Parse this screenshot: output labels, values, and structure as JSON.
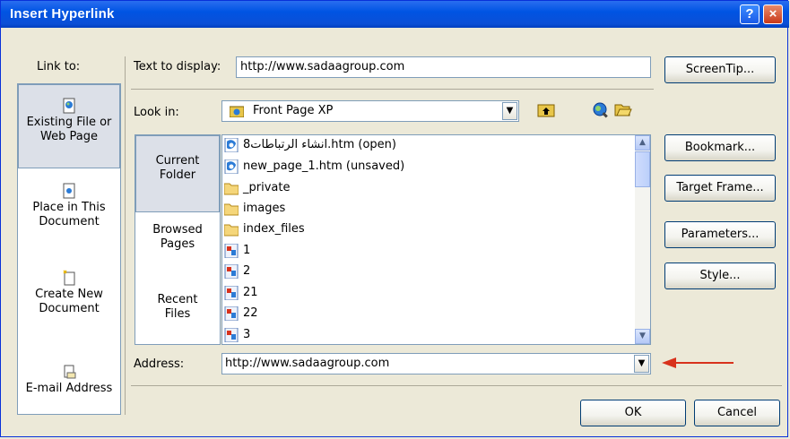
{
  "window": {
    "title": "Insert Hyperlink",
    "help": "?",
    "close": "×"
  },
  "link_to": {
    "label": "Link to:",
    "items": [
      {
        "label1": "Existing File or",
        "label2": "Web Page",
        "icon": "web-page-icon"
      },
      {
        "label1": "Place in This",
        "label2": "Document",
        "icon": "document-place-icon"
      },
      {
        "label1": "Create New",
        "label2": "Document",
        "icon": "new-document-icon"
      },
      {
        "label1": "E-mail Address",
        "label2": "",
        "icon": "email-icon"
      }
    ]
  },
  "text_to_display": {
    "label": "Text to display:",
    "value": "http://www.sadaagroup.com"
  },
  "screentip": "ScreenTip...",
  "look_in": {
    "label": "Look in:",
    "value": "Front Page XP"
  },
  "side": [
    {
      "label1": "Current",
      "label2": "Folder"
    },
    {
      "label1": "Browsed",
      "label2": "Pages"
    },
    {
      "label1": "Recent",
      "label2": "Files"
    }
  ],
  "files": [
    {
      "name": "انشاء الرتباطات8.htm (open)",
      "icon": "html-file-icon"
    },
    {
      "name": "new_page_1.htm (unsaved)",
      "icon": "html-file-icon"
    },
    {
      "name": "_private",
      "icon": "folder-icon"
    },
    {
      "name": "images",
      "icon": "folder-icon"
    },
    {
      "name": "index_files",
      "icon": "folder-icon"
    },
    {
      "name": "1",
      "icon": "image-file-icon"
    },
    {
      "name": "2",
      "icon": "image-file-icon"
    },
    {
      "name": "21",
      "icon": "image-file-icon"
    },
    {
      "name": "22",
      "icon": "image-file-icon"
    },
    {
      "name": "3",
      "icon": "image-file-icon"
    }
  ],
  "buttons": {
    "bookmark": "Bookmark...",
    "target_frame": "Target Frame...",
    "parameters": "Parameters...",
    "style": "Style...",
    "ok": "OK",
    "cancel": "Cancel"
  },
  "address": {
    "label": "Address:",
    "value": "http://www.sadaagroup.com"
  },
  "colors": {
    "title_bar": "#0054e3",
    "dialog_bg": "#ece9d8",
    "arrow": "#d8321c"
  }
}
